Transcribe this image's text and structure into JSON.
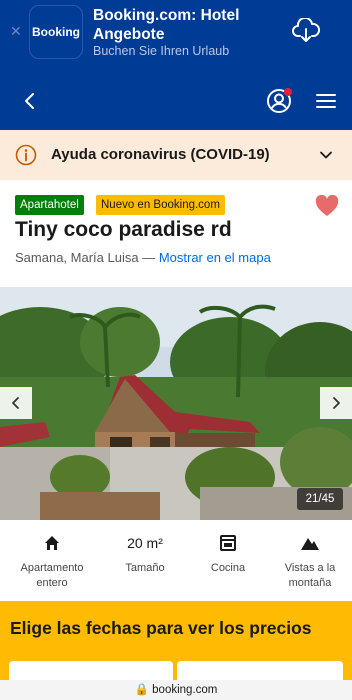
{
  "app_banner": {
    "logo_text": "Booking",
    "title": "Booking.com: Hotel Angebote",
    "subtitle": "Buchen Sie Ihren Urlaub",
    "close_icon": "close-icon",
    "download_icon": "cloud-download-icon"
  },
  "nav": {
    "back_icon": "chevron-left-icon",
    "account_icon": "account-icon",
    "menu_icon": "hamburger-menu-icon"
  },
  "covid": {
    "text": "Ayuda coronavirus (COVID-19)",
    "icon": "info-icon"
  },
  "property": {
    "type_badge": "Apartahotel",
    "new_badge": "Nuevo en Booking.com",
    "name": "Tiny coco paradise rd",
    "location": "Samana, María Luisa —",
    "map_link": "Mostrar en el mapa"
  },
  "gallery": {
    "counter": "21/45"
  },
  "facilities": [
    {
      "icon": "home-icon",
      "label": "Apartamento entero"
    },
    {
      "icon_text": "20 m²",
      "label": "Tamaño"
    },
    {
      "icon": "oven-icon",
      "label": "Cocina"
    },
    {
      "icon": "mountain-icon",
      "label": "Vistas a la montaña"
    }
  ],
  "dates": {
    "title": "Elige las fechas para ver los precios"
  },
  "url_bar": {
    "domain": "booking.com"
  },
  "colors": {
    "brand_blue": "#003b95",
    "covid_bg": "#fcebdb",
    "badge_green": "#008009",
    "badge_yellow": "#febb02",
    "link_blue": "#006ce4",
    "heart": "#e86a6a"
  }
}
